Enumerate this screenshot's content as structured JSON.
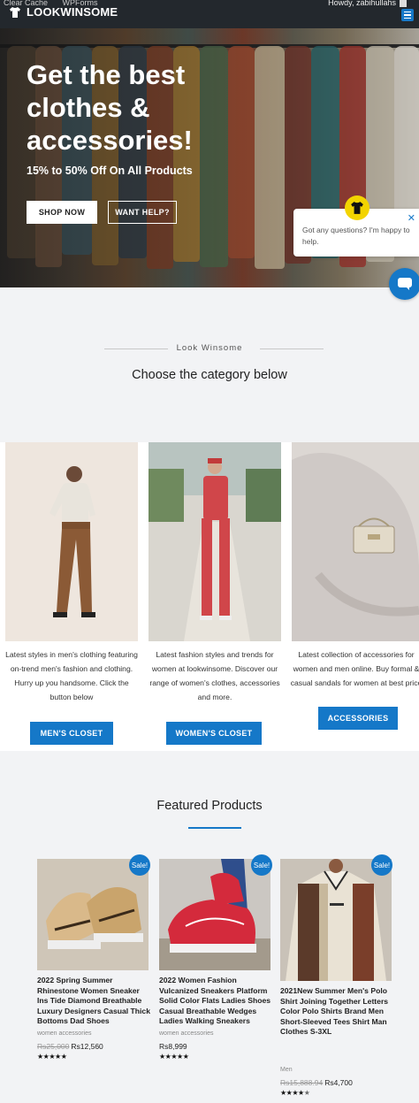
{
  "admin_bar": {
    "links": [
      "Clear Cache",
      "WPForms"
    ],
    "greeting": "Howdy, zabihullahs"
  },
  "header": {
    "logo_text": "LOOKWINSOME",
    "menu_icon": "hamburger-icon"
  },
  "hero": {
    "title": "Get the best clothes & accessories!",
    "subtitle": "15% to 50% Off On All Products",
    "shop_label": "SHOP NOW",
    "help_label": "WANT HELP?"
  },
  "chat": {
    "message": "Got any questions? I'm happy to help.",
    "close_icon": "close-icon",
    "launcher_icon": "chat-bubble-icon"
  },
  "categories_section": {
    "eyebrow": "Look Winsome",
    "title": "Choose the category below",
    "items": [
      {
        "description": "Latest styles in men's clothing featuring on-trend men's fashion and clothing. Hurry up you handsome. Click the button below",
        "button": "MEN'S CLOSET"
      },
      {
        "description": "Latest fashion styles and trends for women at lookwinsome. Discover our range of women's clothes, accessories and more.",
        "button": "WOMEN'S CLOSET"
      },
      {
        "description": "Latest collection of accessories for women and men online. Buy formal & casual sandals for women at best price",
        "button": "ACCESSORIES"
      }
    ]
  },
  "featured": {
    "title": "Featured Products",
    "products": [
      {
        "badge": "Sale!",
        "name": "2022 Spring Summer Rhinestone Women Sneaker Ins Tide Diamond Breathable Luxury Designers Casual Thick Bottoms Dad Shoes",
        "category": "women accessories",
        "old_price": "Rs25,000",
        "price": "Rs12,560",
        "rating": 5
      },
      {
        "badge": "Sale!",
        "name": "2022 Women Fashion Vulcanized Sneakers Platform Solid Color Flats Ladies Shoes Casual Breathable Wedges Ladies Walking Sneakers",
        "category": "women accessories",
        "old_price": "",
        "price": "Rs8,999",
        "rating": 5
      },
      {
        "badge": "Sale!",
        "name": "2021New Summer Men's Polo Shirt Joining Together Letters Color Polo Shirts Brand Men Short-Sleeved Tees Shirt Man Clothes S-3XL",
        "category": "Men",
        "old_price": "Rs15,888.94",
        "price": "Rs4,700",
        "rating": 4.5
      }
    ]
  },
  "colors": {
    "accent": "#1578c8",
    "admin_bar": "#23282d",
    "section_bg": "#f2f3f5"
  }
}
